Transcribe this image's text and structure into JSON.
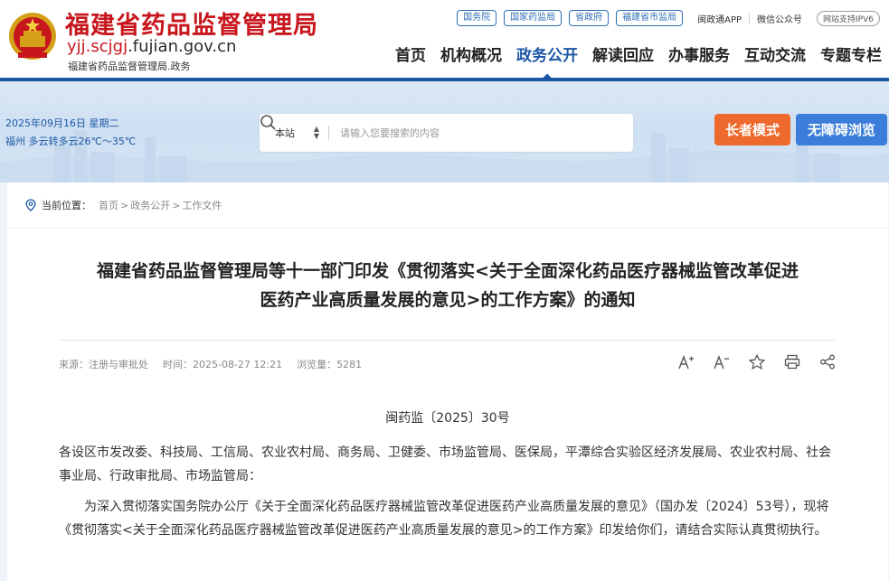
{
  "header": {
    "site_name": "福建省药品监督管理局",
    "domain": "yjj.scjgj.fujian.gov.cn",
    "domain_highlight": "yjj.scjgj",
    "domain_rest": ".fujian.gov.cn",
    "sub_name": "福建省药品监督管理局.政务",
    "top_tags": [
      "国务院",
      "国家药监局",
      "省政府",
      "福建省市监局"
    ],
    "top_links": [
      "闽政通APP",
      "微信公众号"
    ],
    "ipv6": "网站支持IPV6"
  },
  "nav": {
    "items": [
      "首页",
      "机构概况",
      "政务公开",
      "解读回应",
      "办事服务",
      "互动交流",
      "专题专栏"
    ],
    "active_index": 2
  },
  "banner": {
    "date": "2025年09月16日 星期二",
    "weather": "福州 多云转多云26℃～35℃",
    "search_scope": "本站",
    "search_placeholder": "请输入您要搜索的内容",
    "elder_mode": "长者模式",
    "accessible": "无障碍浏览"
  },
  "breadcrumb": {
    "label": "当前位置：",
    "items": [
      "首页",
      "政务公开",
      "工作文件"
    ]
  },
  "article": {
    "title_line1": "福建省药品监督管理局等十一部门印发《贯彻落实<关于全面深化药品医疗器械监管改革促进",
    "title_line2": "医药产业高质量发展的意见>的工作方案》的通知",
    "source": "来源：注册与审批处",
    "time": "时间：2025-08-27 12:21",
    "views": "浏览量：5281",
    "doc_no": "闽药监〔2025〕30号",
    "addressees": "各设区市发改委、科技局、工信局、农业农村局、商务局、卫健委、市场监管局、医保局，平潭综合实验区经济发展局、农业农村局、社会事业局、行政审批局、市场监管局：",
    "para1": "为深入贯彻落实国务院办公厅《关于全面深化药品医疗器械监管改革促进医药产业高质量发展的意见》（国办发〔2024〕53号），现将《贯彻落实<关于全面深化药品医疗器械监管改革促进医药产业高质量发展的意见>的工作方案》印发给你们，请结合实际认真贯彻执行。"
  },
  "colors": {
    "brand_red": "#c8161d",
    "brand_blue": "#1c57a5",
    "elder_orange": "#ee6a2c",
    "access_blue": "#3b7dd8"
  }
}
